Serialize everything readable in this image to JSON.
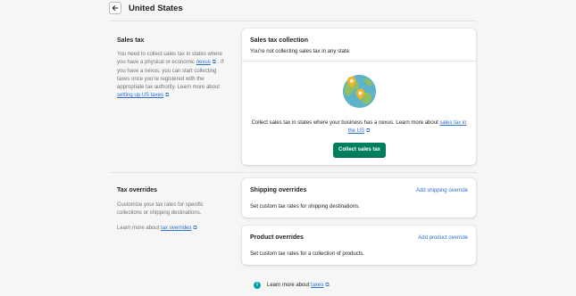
{
  "header": {
    "title": "United States"
  },
  "sales_tax": {
    "heading": "Sales tax",
    "desc_1": "You need to collect sales tax in states where",
    "desc_2": "you have a physical or economic",
    "nexus_link": "nexus",
    "desc_3": ". If",
    "desc_4": "you have a nexus, you can start collecting",
    "desc_5": "taxes once you're registered with the",
    "desc_6": "appropriate tax authority. Learn more about",
    "setup_link": "setting up US taxes",
    "card": {
      "title": "Sales tax collection",
      "status": "You're not collecting sales tax in any state.",
      "promo_text": "Collect sales tax in states where your business has a nexus. Learn more about",
      "promo_link_1": "sales tax in",
      "promo_link_2": "the US",
      "button": "Collect sales tax"
    }
  },
  "tax_overrides": {
    "heading": "Tax overrides",
    "desc_1": "Customize your tax rates for specific",
    "desc_2": "collections or shipping destinations.",
    "learn_prefix": "Learn more about",
    "learn_link": "tax overrides",
    "shipping": {
      "title": "Shipping overrides",
      "action": "Add shipping override",
      "text": "Set custom tax rates for shipping destinations."
    },
    "product": {
      "title": "Product overrides",
      "action": "Add product override",
      "text": "Set custom tax rates for a collection of products."
    }
  },
  "footer": {
    "prefix": "Learn more about",
    "link": "taxes"
  },
  "colors": {
    "primary_button": "#007f5f",
    "link": "#2c6ecb",
    "info": "#00a0ac"
  },
  "icons": [
    "arrow-left-icon",
    "external-link-icon",
    "globe-illustration",
    "info-icon"
  ]
}
